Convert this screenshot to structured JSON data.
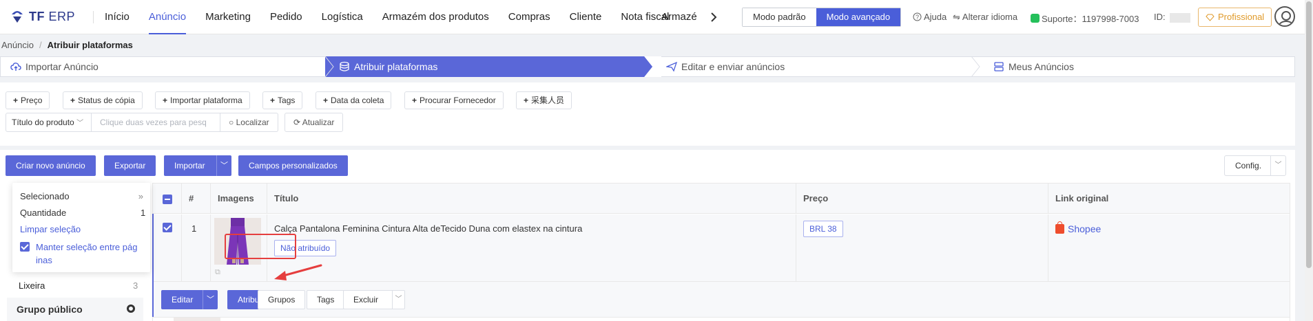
{
  "app": {
    "logo_bold": "TF",
    "logo_rest": " ERP",
    "nav": [
      "Início",
      "Anúncio",
      "Marketing",
      "Pedido",
      "Logística",
      "Armazém dos produtos",
      "Compras",
      "Cliente",
      "Nota fiscal",
      "Armazém"
    ],
    "nav_active": "Anúncio",
    "mode_default": "Modo padrão",
    "mode_advanced": "Modo avançado",
    "help": "Ajuda",
    "language": "Alterar idioma",
    "support": "Suporte：1197998-7003",
    "id_label": "ID:",
    "plan": "Profissional"
  },
  "breadcrumb": {
    "parent": "Anúncio",
    "separator": "/",
    "current": "Atribuir plataformas"
  },
  "steps": [
    "Importar Anúncio",
    "Atribuir plataformas",
    "Editar e enviar anúncios",
    "Meus Anúncios"
  ],
  "filters": {
    "chips": [
      "Preço",
      "Status de cópia",
      "Importar plataforma",
      "Tags",
      "Data da coleta",
      "Procurar Fornecedor",
      "采集人员"
    ],
    "search_select": "Título do produto",
    "search_placeholder": "Clique duas vezes para pesq",
    "locate": "Localizar",
    "refresh": "Atualizar"
  },
  "toolbar": {
    "create": "Criar novo anúncio",
    "export": "Exportar",
    "import": "Importar",
    "custom_fields": "Campos personalizados",
    "config": "Config."
  },
  "selection": {
    "selected": "Selecionado",
    "quantity_label": "Quantidade",
    "quantity": "1",
    "clear": "Limpar seleção",
    "keep_line1": "Manter seleção entre pág",
    "keep_line2": "inas"
  },
  "groups": {
    "trash": "Lixeira",
    "trash_count": "3",
    "public": "Grupo público"
  },
  "table": {
    "headers": [
      "#",
      "Imagens",
      "Título",
      "Preço",
      "Link original"
    ],
    "rows": [
      {
        "index": "1",
        "title": "Calça Pantalona Feminina Cintura Alta deTecido Duna com elastex na cintura",
        "status": "Não atribuído",
        "price": "BRL  38",
        "link": "Shopee"
      }
    ],
    "actions": {
      "edit": "Editar",
      "assign": "Atribuir",
      "groups": "Grupos",
      "tags": "Tags",
      "delete": "Excluir"
    }
  },
  "colors": {
    "primary": "#5a67d8",
    "highlight": "#e53e3e",
    "shopee": "#ee4d2d",
    "plan": "#e09a2a"
  }
}
